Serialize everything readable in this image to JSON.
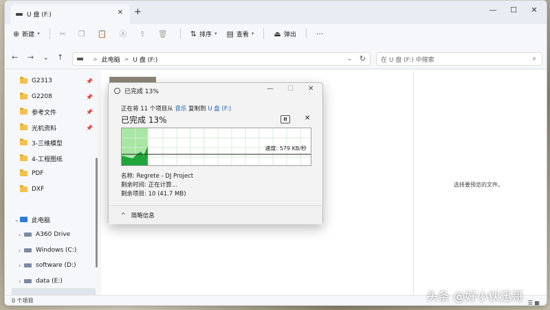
{
  "tab": {
    "title": "U 盘 (F:)",
    "close": "✕",
    "new": "+"
  },
  "window_controls": {
    "minimize": "—",
    "maximize": "☐",
    "close": "✕"
  },
  "toolbar": {
    "new_label": "新建",
    "sort_label": "排序",
    "view_label": "查看",
    "eject_label": "弹出",
    "more": "···"
  },
  "nav": {
    "back": "←",
    "forward": "→",
    "recent": "⌄",
    "up": "↑"
  },
  "address": {
    "part1": "此电脑",
    "part2": "U 盘 (F:)",
    "chevron": ">"
  },
  "search": {
    "placeholder": "在 U 盘 (F:) 中搜索"
  },
  "sidebar": {
    "quick": [
      {
        "label": "G2313",
        "pinned": true
      },
      {
        "label": "G2208",
        "pinned": true
      },
      {
        "label": "参考文件",
        "pinned": true
      },
      {
        "label": "光机资料",
        "pinned": true
      },
      {
        "label": "3-三维模型",
        "pinned": false
      },
      {
        "label": "4-工程图纸",
        "pinned": false
      },
      {
        "label": "PDF",
        "pinned": false
      },
      {
        "label": "DXF",
        "pinned": false
      }
    ],
    "this_pc": "此电脑",
    "drives": [
      {
        "label": "A360 Drive"
      },
      {
        "label": "Windows (C:)"
      },
      {
        "label": "software (D:)"
      },
      {
        "label": "data (E:)"
      }
    ]
  },
  "preview": {
    "text": "选择要预览的文件。"
  },
  "status": {
    "items": "0 个项目"
  },
  "dialog": {
    "title": "已完成 13%",
    "line1_prefix": "正在将 11 个项目从",
    "source": "音乐",
    "line1_mid": "复制到",
    "dest": "U 盘 (F:)",
    "big_status": "已完成 13%",
    "pause": "II",
    "cancel": "✕",
    "speed": "速度: 579 KB/秒",
    "progress_fraction": 0.13,
    "name_line": "名称: Regrete - DJ Project",
    "time_line": "剩余时间: 正在计算...",
    "items_line": "剩余项目: 10 (41.7 MB)",
    "details": "简略信息",
    "details_chevron": "^"
  },
  "watermark": "头条 @好小伙迅哥",
  "colors": {
    "accent": "#1a5fb4",
    "progress_fill": "#a8e6a3",
    "graph_fill": "#1fa53a"
  }
}
